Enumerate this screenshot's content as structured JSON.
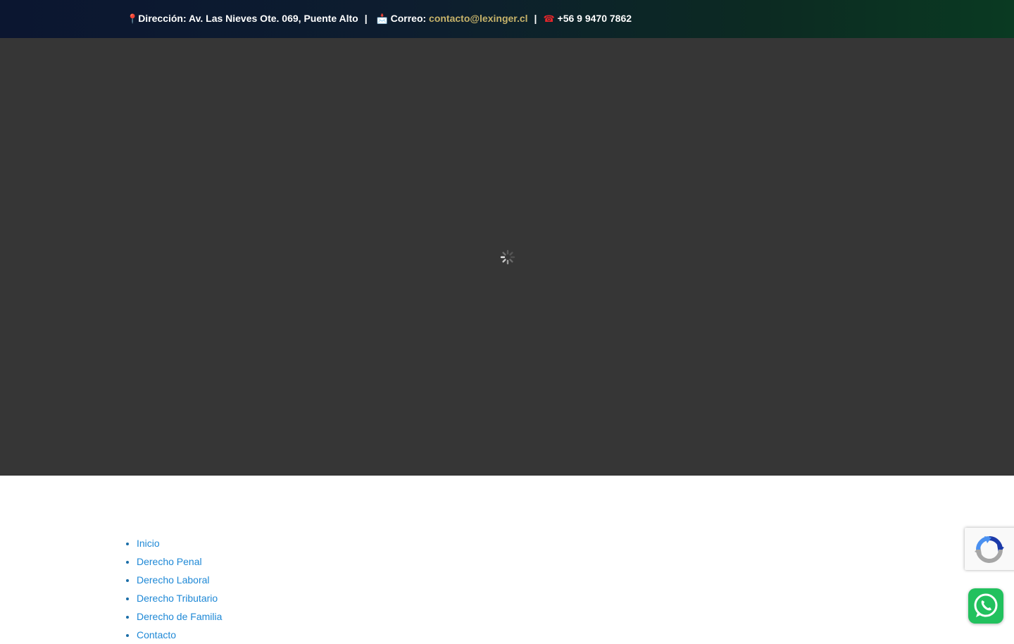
{
  "topbar": {
    "address_label": "Dirección: Av. Las Nieves Ote. 069, Puente Alto",
    "separator": "|",
    "email_label": "Correo:",
    "email": "contacto@lexinger.cl",
    "phone": "+56 9 9470 7862",
    "icons": [
      "pin-icon",
      "mail-icon",
      "telephone-icon"
    ]
  },
  "loader": {
    "icon": "spinner-icon",
    "background": "#363636"
  },
  "nav": {
    "items": [
      {
        "label": "Inicio"
      },
      {
        "label": "Derecho Penal"
      },
      {
        "label": "Derecho Laboral"
      },
      {
        "label": "Derecho Tributario"
      },
      {
        "label": "Derecho de Familia"
      },
      {
        "label": "Contacto"
      }
    ]
  },
  "widgets": {
    "recaptcha_icon": "recaptcha-icon",
    "whatsapp_icon": "whatsapp-icon"
  },
  "colors": {
    "link": "#1e88d6",
    "email_accent": "#c7b36a",
    "whatsapp": "#22c15e"
  }
}
